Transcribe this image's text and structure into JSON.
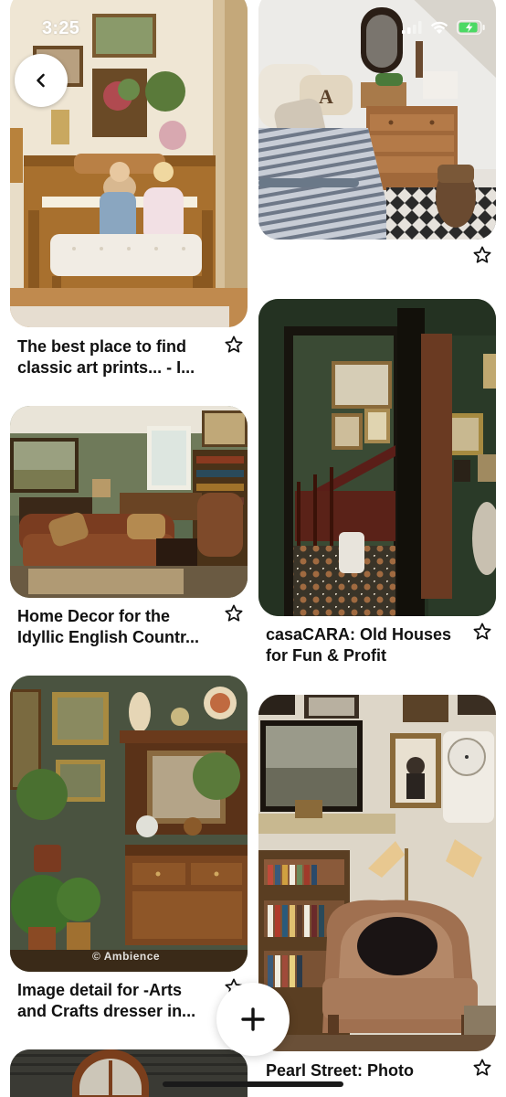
{
  "status_bar": {
    "time": "3:25",
    "icons": [
      "signal-icon",
      "wifi-icon",
      "battery-charging-icon"
    ]
  },
  "nav": {
    "back_icon": "chevron-left-icon"
  },
  "pins": [
    {
      "column": "left",
      "title": "The best place to find classic art prints... - I...",
      "image": "Children at a wooden piano in a cottage room"
    },
    {
      "column": "left",
      "title": "Home Decor for the Idyllic English Countr...",
      "image": "Victorian living room with leather sofa"
    },
    {
      "column": "left",
      "title": "Image detail for -Arts and Crafts dresser in...",
      "image": "Dark green room with carved wooden dresser",
      "watermark": "© Ambience"
    },
    {
      "column": "left",
      "title": "",
      "image": "Wooden arched window (partially visible)"
    },
    {
      "column": "right",
      "title": "",
      "image": "Cottage bedroom with striped bedding"
    },
    {
      "column": "right",
      "title": "casaCARA: Old Houses for Fun & Profit",
      "image": "Dark hallway looking into tiled entry"
    },
    {
      "column": "right",
      "title": "Pearl Street: Photo",
      "image": "Reading nook with velvet armchair and bookshelf"
    }
  ],
  "actions": {
    "add_icon": "plus-icon"
  },
  "colors": {
    "background": "#ffffff",
    "text": "#111111",
    "star": "#111111"
  }
}
